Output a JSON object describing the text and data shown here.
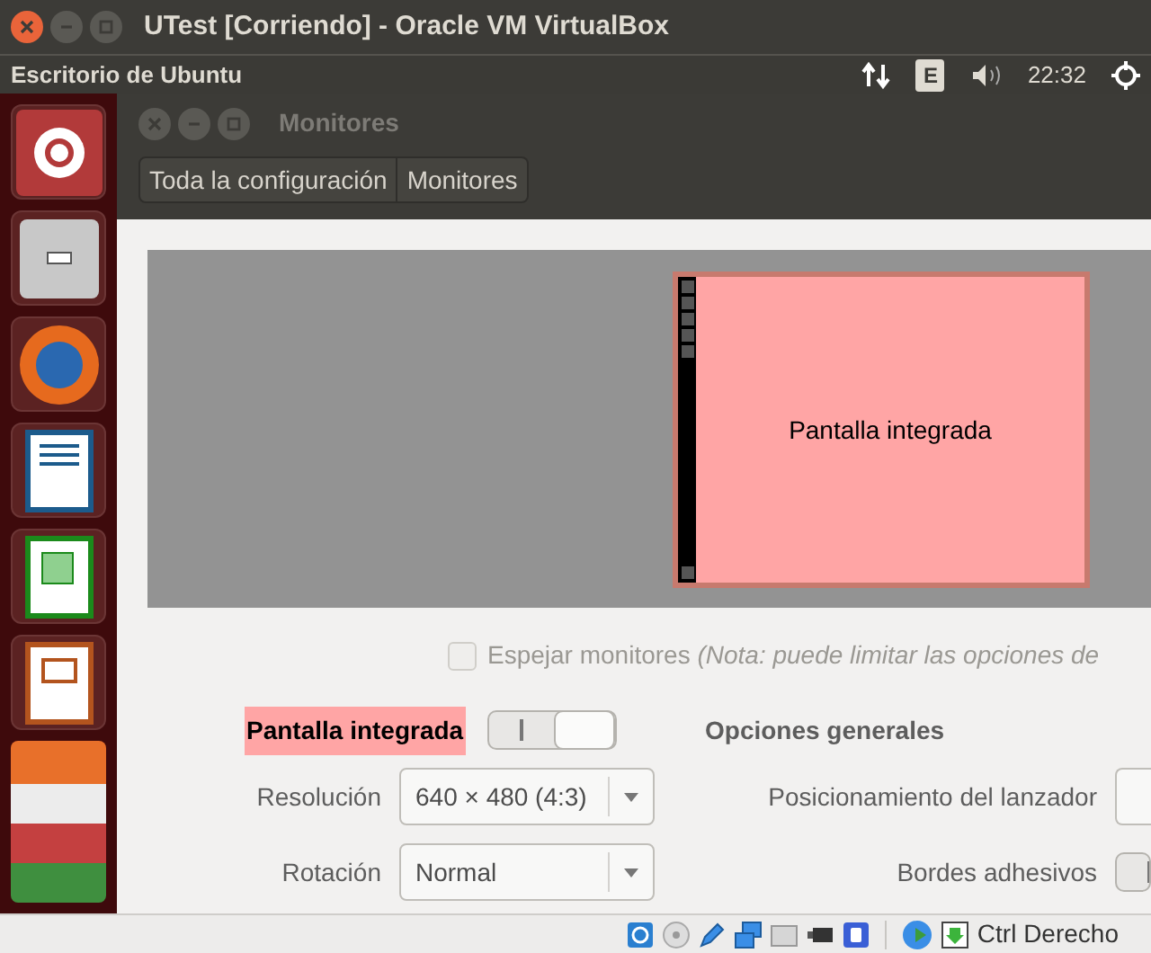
{
  "window": {
    "title": "UTest [Corriendo] - Oracle VM VirtualBox"
  },
  "panel": {
    "title": "Escritorio de Ubuntu",
    "keyboard": "E",
    "clock": "22:32"
  },
  "launcher": {
    "items": [
      {
        "kind": "dash"
      },
      {
        "kind": "files"
      },
      {
        "kind": "browser"
      },
      {
        "kind": "writer"
      },
      {
        "kind": "calc"
      },
      {
        "kind": "impress"
      }
    ]
  },
  "settings_window": {
    "title": "Monitores",
    "breadcrumbs": [
      "Toda la configuración",
      "Monitores"
    ]
  },
  "display_preview": {
    "monitor_label": "Pantalla integrada"
  },
  "mirror": {
    "label": "Espejar monitores *(Nota: puede limitar las opciones de*",
    "checked": false,
    "disabled": true
  },
  "display": {
    "name": "Pantalla integrada",
    "on": true,
    "resolution": {
      "label": "Resolución",
      "value": "640 × 480 (4:3)"
    },
    "rotation": {
      "label": "Rotación",
      "value": "Normal"
    }
  },
  "general": {
    "title": "Opciones generales",
    "launcher_placement": {
      "label": "Posicionamiento del lanzador"
    },
    "sticky_edges": {
      "label": "Bordes adhesivos",
      "on": true
    }
  },
  "status_bar": {
    "host_key": "Ctrl Derecho"
  }
}
